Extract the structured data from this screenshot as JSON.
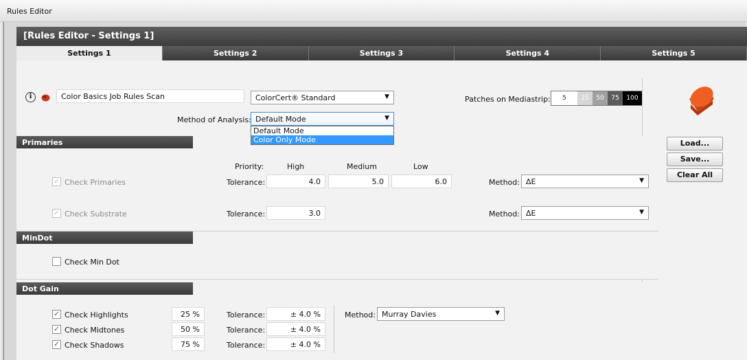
{
  "window": {
    "title": "Rules Editor"
  },
  "header": {
    "title": "[Rules Editor - Settings 1]"
  },
  "tabs": [
    "Settings 1",
    "Settings 2",
    "Settings 3",
    "Settings 4",
    "Settings 5"
  ],
  "job": {
    "name_value": "Color Basics Job Rules Scan",
    "standard_value": "ColorCert® Standard",
    "method_label": "Method of Analysis:",
    "method_value": "Default Mode",
    "method_options": [
      "Default Mode",
      "Color Only Mode"
    ],
    "patches_label": "Patches on Mediastrip:",
    "patches": [
      "5",
      "25",
      "50",
      "75",
      "100"
    ]
  },
  "buttons": {
    "load": "Load...",
    "save": "Save...",
    "clear": "Clear All"
  },
  "primaries": {
    "title": "Primaries",
    "priority_label": "Priority:",
    "priority_high": "High",
    "priority_medium": "Medium",
    "priority_low": "Low",
    "check_primaries": "Check Primaries",
    "tolerance_label": "Tolerance:",
    "tol_high": "4.0",
    "tol_medium": "5.0",
    "tol_low": "6.0",
    "method_label": "Method:",
    "method_value": "ΔE",
    "check_substrate": "Check Substrate",
    "substrate_tol_label": "Tolerance:",
    "substrate_tol": "3.0",
    "substrate_method_label": "Method:",
    "substrate_method_value": "ΔE"
  },
  "mindot": {
    "title": "MinDot",
    "check_min_dot": "Check Min Dot"
  },
  "dotgain": {
    "title": "Dot Gain",
    "method_label": "Method:",
    "method_value": "Murray Davies",
    "rows": [
      {
        "label": "Check Highlights",
        "percent": "25 %",
        "tol_label": "Tolerance:",
        "tol": "± 4.0 %"
      },
      {
        "label": "Check Midtones",
        "percent": "50 %",
        "tol_label": "Tolerance:",
        "tol": "± 4.0 %"
      },
      {
        "label": "Check Shadows",
        "percent": "75 %",
        "tol_label": "Tolerance:",
        "tol": "± 4.0 %"
      }
    ]
  },
  "colors": {
    "accent": "#3399ff",
    "header": "#4a4a4a",
    "puck": "#e8531a"
  }
}
